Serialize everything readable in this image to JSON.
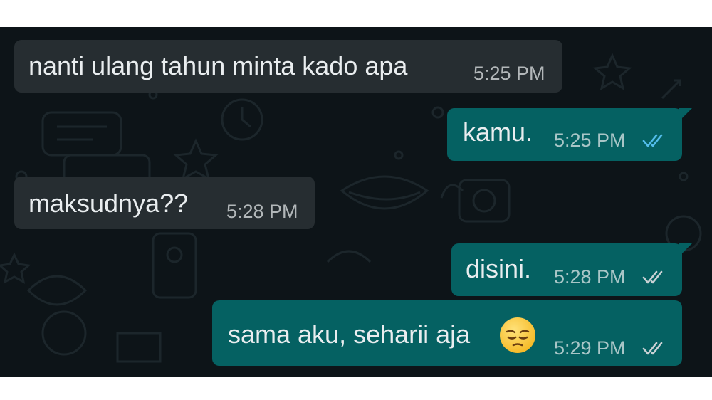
{
  "messages": [
    {
      "text": "nanti ulang tahun minta kado apa",
      "time": "5:25 PM",
      "direction": "incoming"
    },
    {
      "text": "kamu.",
      "time": "5:25 PM",
      "direction": "outgoing",
      "status": "read"
    },
    {
      "text": "maksudnya??",
      "time": "5:28 PM",
      "direction": "incoming"
    },
    {
      "text": "disini.",
      "time": "5:28 PM",
      "direction": "outgoing",
      "status": "delivered"
    },
    {
      "text": "sama aku, seharii aja",
      "time": "5:29 PM",
      "direction": "outgoing",
      "status": "delivered",
      "emoji": "pensive-face-emoji"
    }
  ],
  "colors": {
    "background": "#0d1418",
    "incoming_bubble": "#262d31",
    "outgoing_bubble": "#056162",
    "read_ticks": "#53bdeb",
    "delivered_ticks": "#c9d1d4"
  }
}
